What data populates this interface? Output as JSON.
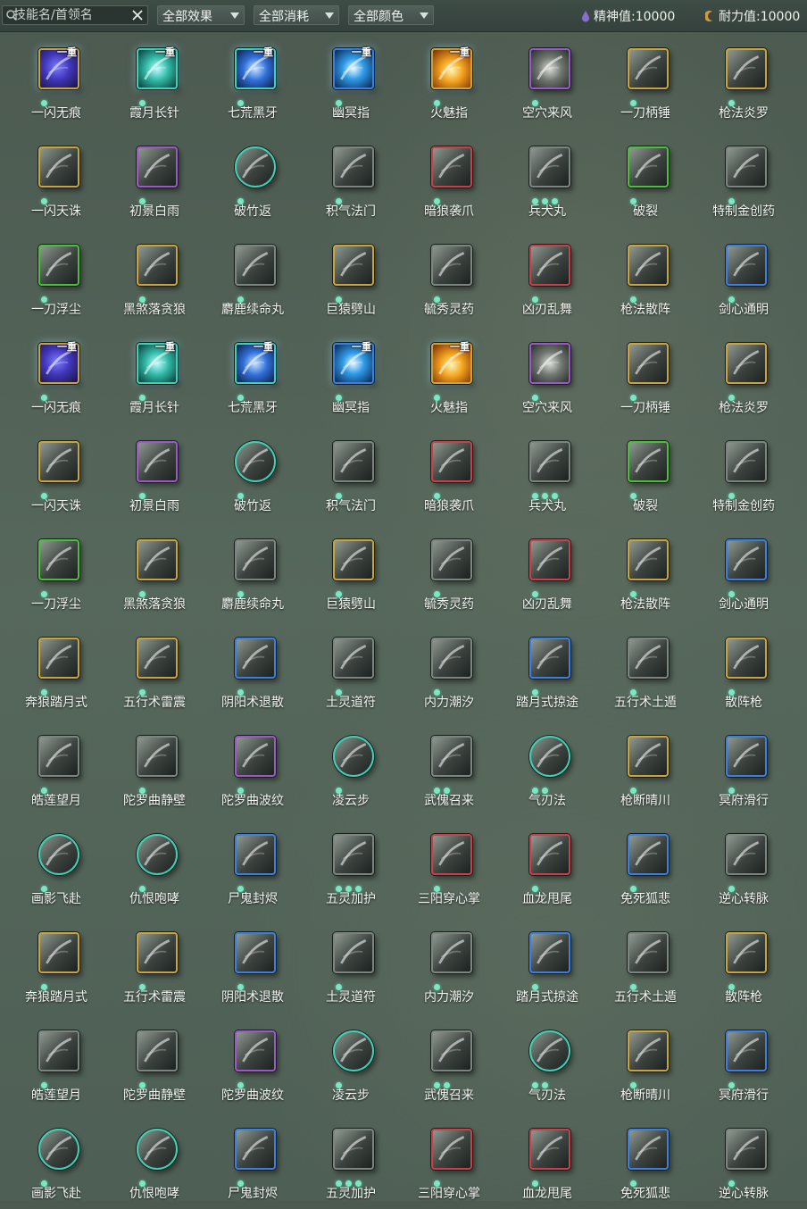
{
  "toolbar": {
    "search_placeholder": "技能名/首领名",
    "filters": [
      {
        "label": "全部效果"
      },
      {
        "label": "全部消耗"
      },
      {
        "label": "全部颜色"
      }
    ],
    "spirit": {
      "label": "精神值:",
      "value": "10000",
      "color": "#9b7bd8"
    },
    "stamina": {
      "label": "耐力值:",
      "value": "10000",
      "color": "#d8a24e"
    }
  },
  "border_colors": {
    "gold": "#c9a43c",
    "green": "#4bbf3a",
    "purple": "#9b58c9",
    "blue": "#3d7fe0",
    "teal": "#3fd0b6",
    "gray": "#7c8680",
    "red": "#c8404a"
  },
  "skills": [
    {
      "name": "一闪无痕",
      "border": "gold",
      "dots": 1,
      "tag": "一重",
      "fx": "purple-glow"
    },
    {
      "name": "霞月长针",
      "border": "teal",
      "dots": 1,
      "tag": "一重",
      "fx": "teal-glow"
    },
    {
      "name": "七荒黑牙",
      "border": "teal",
      "dots": 1,
      "tag": "一重",
      "fx": "blue-glow"
    },
    {
      "name": "幽冥指",
      "border": "blue",
      "dots": 1,
      "tag": "一重",
      "fx": "blue-bright"
    },
    {
      "name": "火魅指",
      "border": "gold",
      "dots": 1,
      "tag": "一重",
      "fx": "fire"
    },
    {
      "name": "空穴来风",
      "border": "purple",
      "dots": 1,
      "tag": "",
      "fx": "coin"
    },
    {
      "name": "一刀柄锤",
      "border": "gold",
      "dots": 1,
      "tag": "",
      "fx": "gray"
    },
    {
      "name": "枪法炎罗",
      "border": "gold",
      "dots": 1,
      "tag": "",
      "fx": "gray"
    },
    {
      "name": "一闪天诛",
      "border": "gold",
      "dots": 1,
      "tag": "",
      "fx": "gray"
    },
    {
      "name": "初景白雨",
      "border": "purple",
      "dots": 1,
      "tag": "",
      "fx": "gray"
    },
    {
      "name": "破竹返",
      "border": "teal",
      "dots": 1,
      "tag": "",
      "fx": "gray-round"
    },
    {
      "name": "积气法门",
      "border": "gray",
      "dots": 1,
      "tag": "",
      "fx": "gray"
    },
    {
      "name": "暗狼袭爪",
      "border": "red",
      "dots": 1,
      "tag": "",
      "fx": "gray"
    },
    {
      "name": "兵犬丸",
      "border": "gray",
      "dots": 3,
      "tag": "",
      "fx": "gray"
    },
    {
      "name": "破裂",
      "border": "green",
      "dots": 1,
      "tag": "",
      "fx": "gray"
    },
    {
      "name": "特制金创药",
      "border": "gray",
      "dots": 1,
      "tag": "",
      "fx": "gray"
    },
    {
      "name": "一刀浮尘",
      "border": "green",
      "dots": 1,
      "tag": "",
      "fx": "gray"
    },
    {
      "name": "黑煞落贪狼",
      "border": "gold",
      "dots": 1,
      "tag": "",
      "fx": "gray"
    },
    {
      "name": "麝鹿续命丸",
      "border": "gray",
      "dots": 1,
      "tag": "",
      "fx": "gray"
    },
    {
      "name": "巨猿劈山",
      "border": "gold",
      "dots": 1,
      "tag": "",
      "fx": "gray"
    },
    {
      "name": "毓秀灵药",
      "border": "gray",
      "dots": 1,
      "tag": "",
      "fx": "gray"
    },
    {
      "name": "凶刃乱舞",
      "border": "red",
      "dots": 1,
      "tag": "",
      "fx": "gray"
    },
    {
      "name": "枪法散阵",
      "border": "gold",
      "dots": 1,
      "tag": "",
      "fx": "gray"
    },
    {
      "name": "剑心通明",
      "border": "blue",
      "dots": 1,
      "tag": "",
      "fx": "gray"
    },
    {
      "name": "一闪无痕",
      "border": "gold",
      "dots": 1,
      "tag": "一重",
      "fx": "purple-glow"
    },
    {
      "name": "霞月长针",
      "border": "teal",
      "dots": 1,
      "tag": "一重",
      "fx": "teal-glow"
    },
    {
      "name": "七荒黑牙",
      "border": "teal",
      "dots": 1,
      "tag": "一重",
      "fx": "blue-glow"
    },
    {
      "name": "幽冥指",
      "border": "blue",
      "dots": 1,
      "tag": "一重",
      "fx": "blue-bright"
    },
    {
      "name": "火魅指",
      "border": "gold",
      "dots": 1,
      "tag": "一重",
      "fx": "fire"
    },
    {
      "name": "空穴来风",
      "border": "purple",
      "dots": 1,
      "tag": "",
      "fx": "coin"
    },
    {
      "name": "一刀柄锤",
      "border": "gold",
      "dots": 1,
      "tag": "",
      "fx": "gray"
    },
    {
      "name": "枪法炎罗",
      "border": "gold",
      "dots": 1,
      "tag": "",
      "fx": "gray"
    },
    {
      "name": "一闪天诛",
      "border": "gold",
      "dots": 1,
      "tag": "",
      "fx": "gray"
    },
    {
      "name": "初景白雨",
      "border": "purple",
      "dots": 1,
      "tag": "",
      "fx": "gray"
    },
    {
      "name": "破竹返",
      "border": "teal",
      "dots": 1,
      "tag": "",
      "fx": "gray-round"
    },
    {
      "name": "积气法门",
      "border": "gray",
      "dots": 1,
      "tag": "",
      "fx": "gray"
    },
    {
      "name": "暗狼袭爪",
      "border": "red",
      "dots": 1,
      "tag": "",
      "fx": "gray"
    },
    {
      "name": "兵犬丸",
      "border": "gray",
      "dots": 3,
      "tag": "",
      "fx": "gray"
    },
    {
      "name": "破裂",
      "border": "green",
      "dots": 1,
      "tag": "",
      "fx": "gray"
    },
    {
      "name": "特制金创药",
      "border": "gray",
      "dots": 1,
      "tag": "",
      "fx": "gray"
    },
    {
      "name": "一刀浮尘",
      "border": "green",
      "dots": 1,
      "tag": "",
      "fx": "gray"
    },
    {
      "name": "黑煞落贪狼",
      "border": "gold",
      "dots": 1,
      "tag": "",
      "fx": "gray"
    },
    {
      "name": "麝鹿续命丸",
      "border": "gray",
      "dots": 1,
      "tag": "",
      "fx": "gray"
    },
    {
      "name": "巨猿劈山",
      "border": "gold",
      "dots": 1,
      "tag": "",
      "fx": "gray"
    },
    {
      "name": "毓秀灵药",
      "border": "gray",
      "dots": 1,
      "tag": "",
      "fx": "gray"
    },
    {
      "name": "凶刃乱舞",
      "border": "red",
      "dots": 1,
      "tag": "",
      "fx": "gray"
    },
    {
      "name": "枪法散阵",
      "border": "gold",
      "dots": 1,
      "tag": "",
      "fx": "gray"
    },
    {
      "name": "剑心通明",
      "border": "blue",
      "dots": 1,
      "tag": "",
      "fx": "gray"
    },
    {
      "name": "奔狼踏月式",
      "border": "gold",
      "dots": 1,
      "tag": "",
      "fx": "gray"
    },
    {
      "name": "五行术雷震",
      "border": "gold",
      "dots": 1,
      "tag": "",
      "fx": "gray"
    },
    {
      "name": "阴阳术退散",
      "border": "blue",
      "dots": 1,
      "tag": "",
      "fx": "gray"
    },
    {
      "name": "土灵道符",
      "border": "gray",
      "dots": 1,
      "tag": "",
      "fx": "gray"
    },
    {
      "name": "内力潮汐",
      "border": "gray",
      "dots": 1,
      "tag": "",
      "fx": "gray"
    },
    {
      "name": "踏月式掠途",
      "border": "blue",
      "dots": 1,
      "tag": "",
      "fx": "gray"
    },
    {
      "name": "五行术土遁",
      "border": "gray",
      "dots": 1,
      "tag": "",
      "fx": "gray"
    },
    {
      "name": "散阵枪",
      "border": "gold",
      "dots": 1,
      "tag": "",
      "fx": "gray"
    },
    {
      "name": "皓莲望月",
      "border": "gray",
      "dots": 1,
      "tag": "",
      "fx": "gray"
    },
    {
      "name": "陀罗曲静壁",
      "border": "gray",
      "dots": 1,
      "tag": "",
      "fx": "gray"
    },
    {
      "name": "陀罗曲波纹",
      "border": "purple",
      "dots": 1,
      "tag": "",
      "fx": "gray"
    },
    {
      "name": "凌云步",
      "border": "teal",
      "dots": 1,
      "tag": "",
      "fx": "gray-round"
    },
    {
      "name": "武傀召来",
      "border": "gray",
      "dots": 2,
      "tag": "",
      "fx": "gray"
    },
    {
      "name": "气刃法",
      "border": "teal",
      "dots": 2,
      "tag": "",
      "fx": "gray-round"
    },
    {
      "name": "枪断晴川",
      "border": "gold",
      "dots": 1,
      "tag": "",
      "fx": "gray"
    },
    {
      "name": "冥府滑行",
      "border": "blue",
      "dots": 1,
      "tag": "",
      "fx": "gray"
    },
    {
      "name": "画影飞赴",
      "border": "teal",
      "dots": 1,
      "tag": "",
      "fx": "gray-round"
    },
    {
      "name": "仇恨咆哮",
      "border": "teal",
      "dots": 1,
      "tag": "",
      "fx": "gray-round"
    },
    {
      "name": "尸鬼封烬",
      "border": "blue",
      "dots": 1,
      "tag": "",
      "fx": "gray"
    },
    {
      "name": "五灵加护",
      "border": "gray",
      "dots": 3,
      "tag": "",
      "fx": "gray"
    },
    {
      "name": "三阳穿心掌",
      "border": "red",
      "dots": 1,
      "tag": "",
      "fx": "gray"
    },
    {
      "name": "血龙甩尾",
      "border": "red",
      "dots": 1,
      "tag": "",
      "fx": "gray"
    },
    {
      "name": "免死狐悲",
      "border": "blue",
      "dots": 1,
      "tag": "",
      "fx": "gray"
    },
    {
      "name": "逆心转脉",
      "border": "gray",
      "dots": 1,
      "tag": "",
      "fx": "gray"
    },
    {
      "name": "奔狼踏月式",
      "border": "gold",
      "dots": 1,
      "tag": "",
      "fx": "gray"
    },
    {
      "name": "五行术雷震",
      "border": "gold",
      "dots": 1,
      "tag": "",
      "fx": "gray"
    },
    {
      "name": "阴阳术退散",
      "border": "blue",
      "dots": 1,
      "tag": "",
      "fx": "gray"
    },
    {
      "name": "土灵道符",
      "border": "gray",
      "dots": 1,
      "tag": "",
      "fx": "gray"
    },
    {
      "name": "内力潮汐",
      "border": "gray",
      "dots": 1,
      "tag": "",
      "fx": "gray"
    },
    {
      "name": "踏月式掠途",
      "border": "blue",
      "dots": 1,
      "tag": "",
      "fx": "gray"
    },
    {
      "name": "五行术土遁",
      "border": "gray",
      "dots": 1,
      "tag": "",
      "fx": "gray"
    },
    {
      "name": "散阵枪",
      "border": "gold",
      "dots": 1,
      "tag": "",
      "fx": "gray"
    },
    {
      "name": "皓莲望月",
      "border": "gray",
      "dots": 1,
      "tag": "",
      "fx": "gray"
    },
    {
      "name": "陀罗曲静壁",
      "border": "gray",
      "dots": 1,
      "tag": "",
      "fx": "gray"
    },
    {
      "name": "陀罗曲波纹",
      "border": "purple",
      "dots": 1,
      "tag": "",
      "fx": "gray"
    },
    {
      "name": "凌云步",
      "border": "teal",
      "dots": 1,
      "tag": "",
      "fx": "gray-round"
    },
    {
      "name": "武傀召来",
      "border": "gray",
      "dots": 2,
      "tag": "",
      "fx": "gray"
    },
    {
      "name": "气刃法",
      "border": "teal",
      "dots": 2,
      "tag": "",
      "fx": "gray-round"
    },
    {
      "name": "枪断晴川",
      "border": "gold",
      "dots": 1,
      "tag": "",
      "fx": "gray"
    },
    {
      "name": "冥府滑行",
      "border": "blue",
      "dots": 1,
      "tag": "",
      "fx": "gray"
    },
    {
      "name": "画影飞赴",
      "border": "teal",
      "dots": 1,
      "tag": "",
      "fx": "gray-round"
    },
    {
      "name": "仇恨咆哮",
      "border": "teal",
      "dots": 1,
      "tag": "",
      "fx": "gray-round"
    },
    {
      "name": "尸鬼封烬",
      "border": "blue",
      "dots": 1,
      "tag": "",
      "fx": "gray"
    },
    {
      "name": "五灵加护",
      "border": "gray",
      "dots": 3,
      "tag": "",
      "fx": "gray"
    },
    {
      "name": "三阳穿心掌",
      "border": "red",
      "dots": 1,
      "tag": "",
      "fx": "gray"
    },
    {
      "name": "血龙甩尾",
      "border": "red",
      "dots": 1,
      "tag": "",
      "fx": "gray"
    },
    {
      "name": "免死狐悲",
      "border": "blue",
      "dots": 1,
      "tag": "",
      "fx": "gray"
    },
    {
      "name": "逆心转脉",
      "border": "gray",
      "dots": 1,
      "tag": "",
      "fx": "gray"
    }
  ]
}
